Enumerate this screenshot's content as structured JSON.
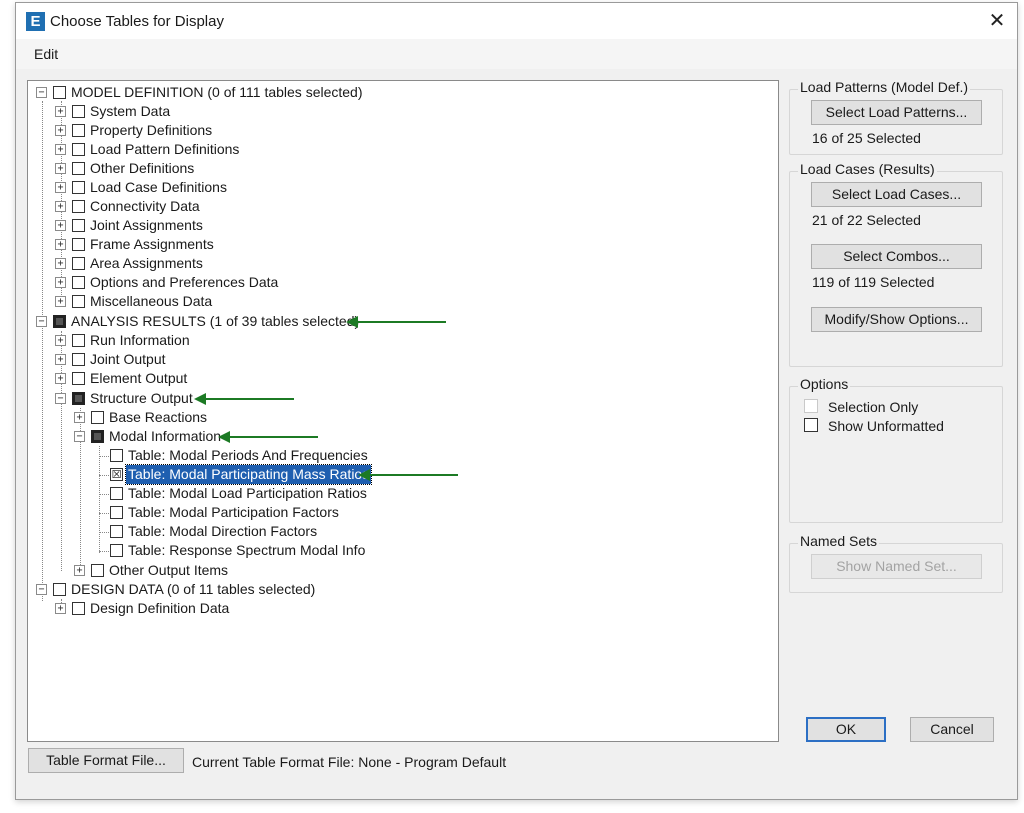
{
  "window": {
    "title": "Choose Tables for Display",
    "app_icon_letter": "E",
    "close_glyph": "✕"
  },
  "menu": {
    "edit": "Edit"
  },
  "tree": {
    "model_definition": {
      "label": "MODEL DEFINITION  (0 of 111 tables selected)",
      "children": [
        "System Data",
        "Property Definitions",
        "Load Pattern Definitions",
        "Other Definitions",
        "Load Case Definitions",
        "Connectivity Data",
        "Joint Assignments",
        "Frame Assignments",
        "Area Assignments",
        "Options and Preferences Data",
        "Miscellaneous Data"
      ]
    },
    "analysis_results": {
      "label": "ANALYSIS RESULTS  (1 of 39 tables selected)",
      "run_information": "Run Information",
      "joint_output": "Joint Output",
      "element_output": "Element Output",
      "structure_output": "Structure Output",
      "base_reactions": "Base Reactions",
      "modal_information": "Modal Information",
      "modal_tables": [
        "Table:  Modal Periods And Frequencies",
        "Table:  Modal Participating Mass Ratios",
        "Table:  Modal Load Participation Ratios",
        "Table:  Modal Participation Factors",
        "Table:  Modal Direction Factors",
        "Table:  Response Spectrum Modal Info"
      ],
      "other_output_items": "Other Output Items"
    },
    "design_data": {
      "label": "DESIGN DATA  (0 of 11 tables selected)",
      "design_definition_data": "Design Definition Data"
    },
    "checked_mark": "☒"
  },
  "load_patterns": {
    "group_title": "Load Patterns (Model Def.)",
    "button": "Select Load Patterns...",
    "status": "16 of 25 Selected"
  },
  "load_cases": {
    "group_title": "Load Cases (Results)",
    "cases_button": "Select Load Cases...",
    "cases_status": "21 of 22 Selected",
    "combos_button": "Select Combos...",
    "combos_status": "119 of 119 Selected",
    "modify_button": "Modify/Show Options..."
  },
  "options": {
    "group_title": "Options",
    "selection_only": "Selection Only",
    "show_unformatted": "Show Unformatted"
  },
  "named_sets": {
    "group_title": "Named Sets",
    "button": "Show Named Set..."
  },
  "footer": {
    "table_format_button": "Table Format File...",
    "current_file_label": "Current Table Format File:  None - Program Default",
    "ok": "OK",
    "cancel": "Cancel"
  },
  "colors": {
    "annotation_arrow": "#1c7a24",
    "selection_highlight": "#1f5fb0"
  }
}
